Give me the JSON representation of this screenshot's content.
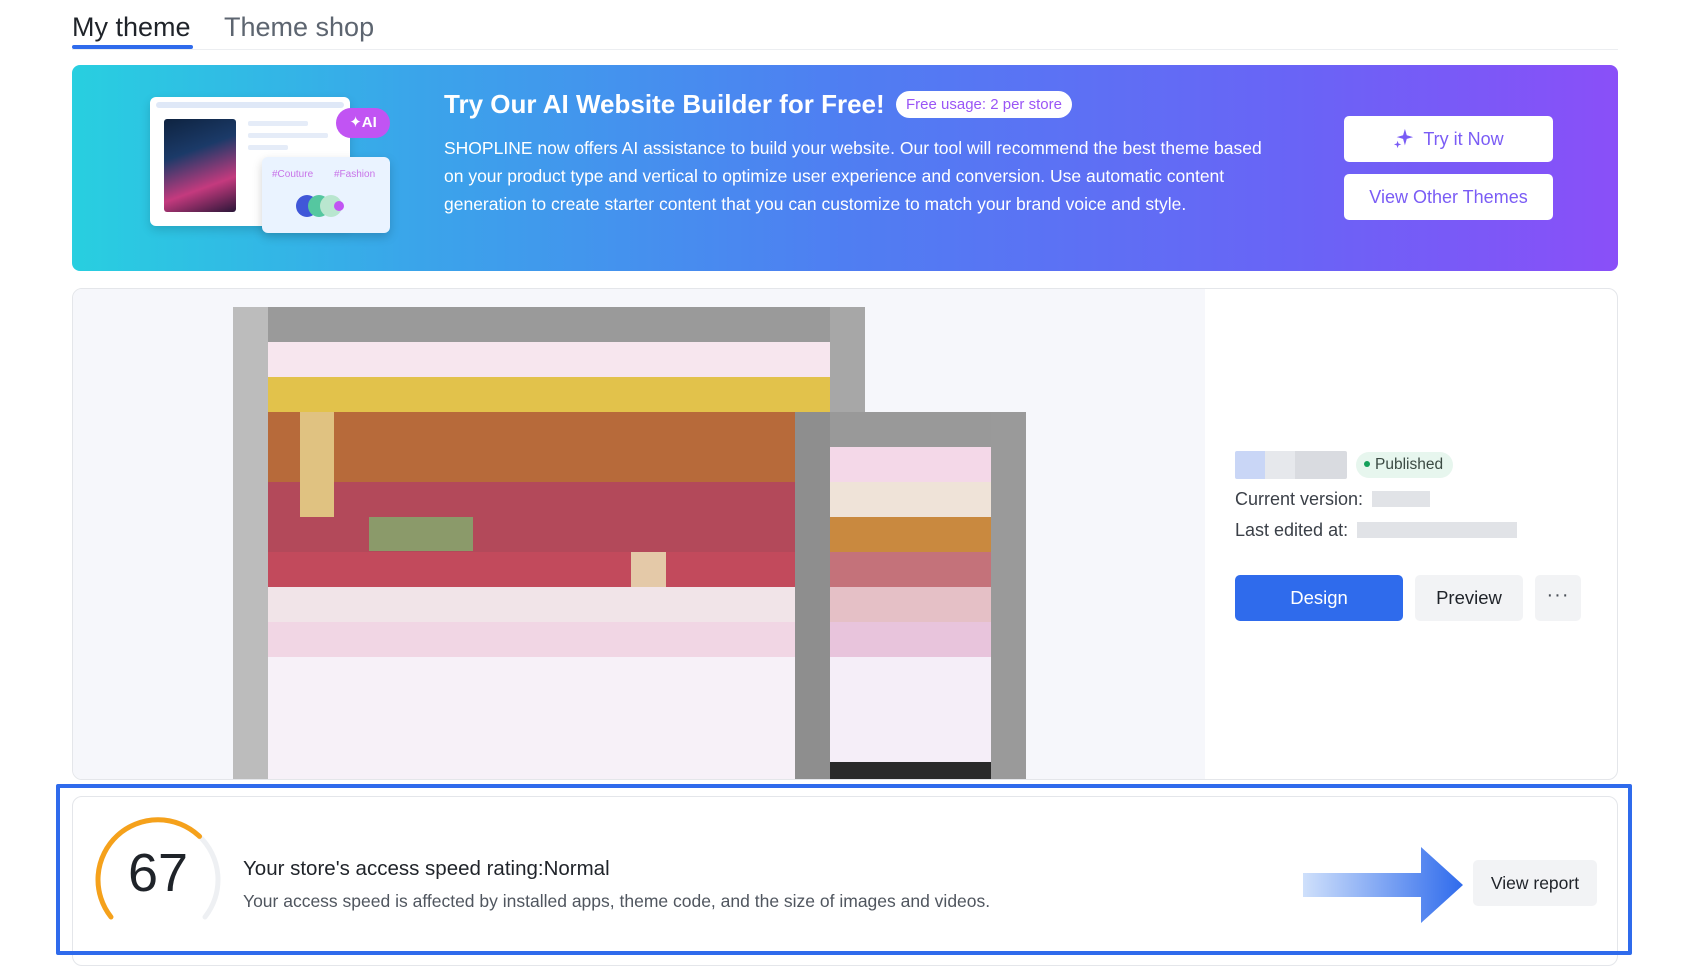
{
  "tabs": {
    "active": "My theme",
    "inactive": "Theme shop"
  },
  "banner": {
    "title": "Try Our AI Website Builder for Free!",
    "badge": "Free usage: 2 per store",
    "description": "SHOPLINE now offers AI assistance to build your website. Our tool will recommend the best theme based on your product type and vertical to optimize user experience and conversion. Use automatic content generation to create starter content that you can customize to match your brand voice and style.",
    "try_button": "Try it Now",
    "view_themes_button": "View Other Themes",
    "illustration": {
      "ai_label": "AI",
      "tag1": "#Couture",
      "tag2": "#Fashion"
    }
  },
  "theme": {
    "status": "Published",
    "current_version_label": "Current version:",
    "last_edited_label": "Last edited at:",
    "design_button": "Design",
    "preview_button": "Preview",
    "more_button": "···"
  },
  "speed": {
    "score": "67",
    "score_value": 67,
    "title": "Your store's access speed rating:Normal",
    "description": "Your access speed is affected by installed apps, theme code, and the size of images and videos.",
    "view_report_button": "View report"
  },
  "colors": {
    "primary": "#2f6bec",
    "gauge": "#f5a11b",
    "published_dot": "#14a05a",
    "banner_start": "#28cfe0",
    "banner_end": "#8a4ff8"
  }
}
